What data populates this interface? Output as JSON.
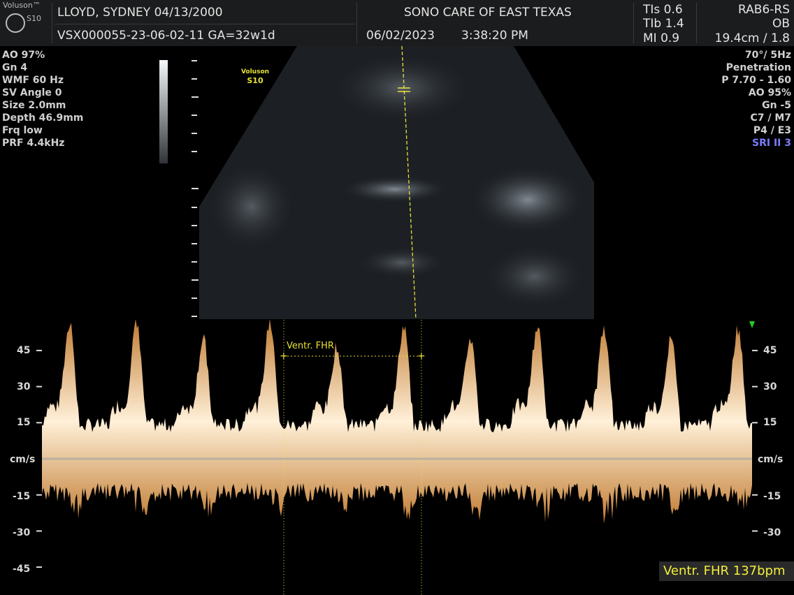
{
  "brand": {
    "name": "Voluson™",
    "model": "S10",
    "logo": "GE"
  },
  "header": {
    "patient": "LLOYD, SYDNEY  04/13/2000",
    "exam_id": "VSX000055-23-06-02-11  GA=32w1d",
    "facility": "SONO CARE OF EAST TEXAS",
    "date": "06/02/2023",
    "time": "3:38:20 PM",
    "tis": "TIs  0.6",
    "tib": "TIb  1.4",
    "mi": "MI  0.9",
    "probe": "RAB6-RS",
    "preset": "OB",
    "depth": "19.4cm / 1.8"
  },
  "left_params": [
    "AO 97%",
    "Gn   4",
    "WMF 60 Hz",
    "SV Angle  0",
    "Size  2.0mm",
    "Depth 46.9mm",
    "Frq low",
    "PRF  4.4kHz"
  ],
  "right_params": [
    "70°/  5Hz",
    "Penetration",
    "P 7.70 - 1.60",
    "AO 95%",
    "Gn  -5",
    "C7 / M7",
    "P4 / E3"
  ],
  "sri": "SRI II 3",
  "image_watermark": {
    "line1": "Voluson",
    "line2": "S10"
  },
  "doppler": {
    "unit": "cm/s",
    "ticks": [
      "45",
      "30",
      "15",
      "-15",
      "-30",
      "-45"
    ],
    "tick_values": [
      45,
      30,
      15,
      -15,
      -30,
      -45
    ],
    "peaks_cms": [
      54,
      54,
      48,
      55,
      45,
      53,
      48,
      53,
      52,
      48,
      52
    ],
    "caliper_label": "Ventr. FHR",
    "result": "Ventr. FHR 137bpm"
  },
  "colors": {
    "spectrum": "#f6d2a0",
    "caliper": "#e8e23a",
    "sri": "#7b7bff"
  }
}
